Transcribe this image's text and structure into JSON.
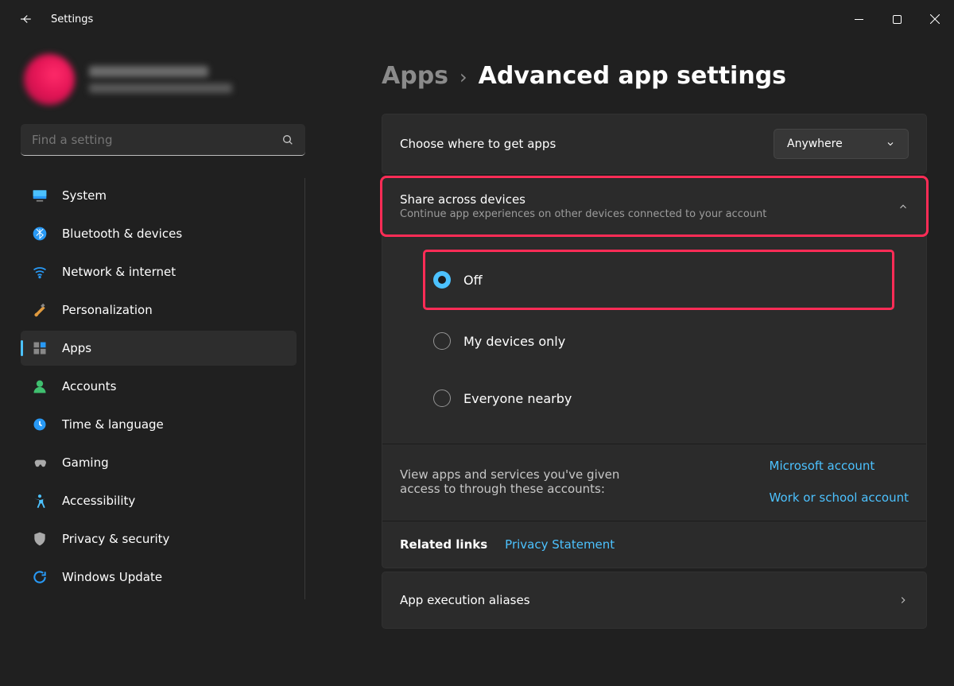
{
  "window": {
    "title": "Settings"
  },
  "profile": {
    "name": "Redacted Name",
    "email": "redacted@example.com"
  },
  "search": {
    "placeholder": "Find a setting"
  },
  "nav": {
    "items": [
      {
        "id": "system",
        "label": "System"
      },
      {
        "id": "bluetooth",
        "label": "Bluetooth & devices"
      },
      {
        "id": "network",
        "label": "Network & internet"
      },
      {
        "id": "personalization",
        "label": "Personalization"
      },
      {
        "id": "apps",
        "label": "Apps"
      },
      {
        "id": "accounts",
        "label": "Accounts"
      },
      {
        "id": "time",
        "label": "Time & language"
      },
      {
        "id": "gaming",
        "label": "Gaming"
      },
      {
        "id": "accessibility",
        "label": "Accessibility"
      },
      {
        "id": "privacy",
        "label": "Privacy & security"
      },
      {
        "id": "update",
        "label": "Windows Update"
      }
    ],
    "selected": "apps"
  },
  "breadcrumb": {
    "root": "Apps",
    "sep": "›",
    "leaf": "Advanced app settings"
  },
  "content": {
    "chooseApps": {
      "title": "Choose where to get apps",
      "value": "Anywhere"
    },
    "shareAcross": {
      "title": "Share across devices",
      "subtitle": "Continue app experiences on other devices connected to your account",
      "expanded": true,
      "options": [
        "Off",
        "My devices only",
        "Everyone nearby"
      ],
      "selected": 0
    },
    "accountsAccess": {
      "label": "View apps and services you've given access to through these accounts:",
      "links": [
        "Microsoft account",
        "Work or school account"
      ]
    },
    "related": {
      "label": "Related links",
      "link": "Privacy Statement"
    },
    "execution": {
      "title": "App execution aliases"
    }
  }
}
